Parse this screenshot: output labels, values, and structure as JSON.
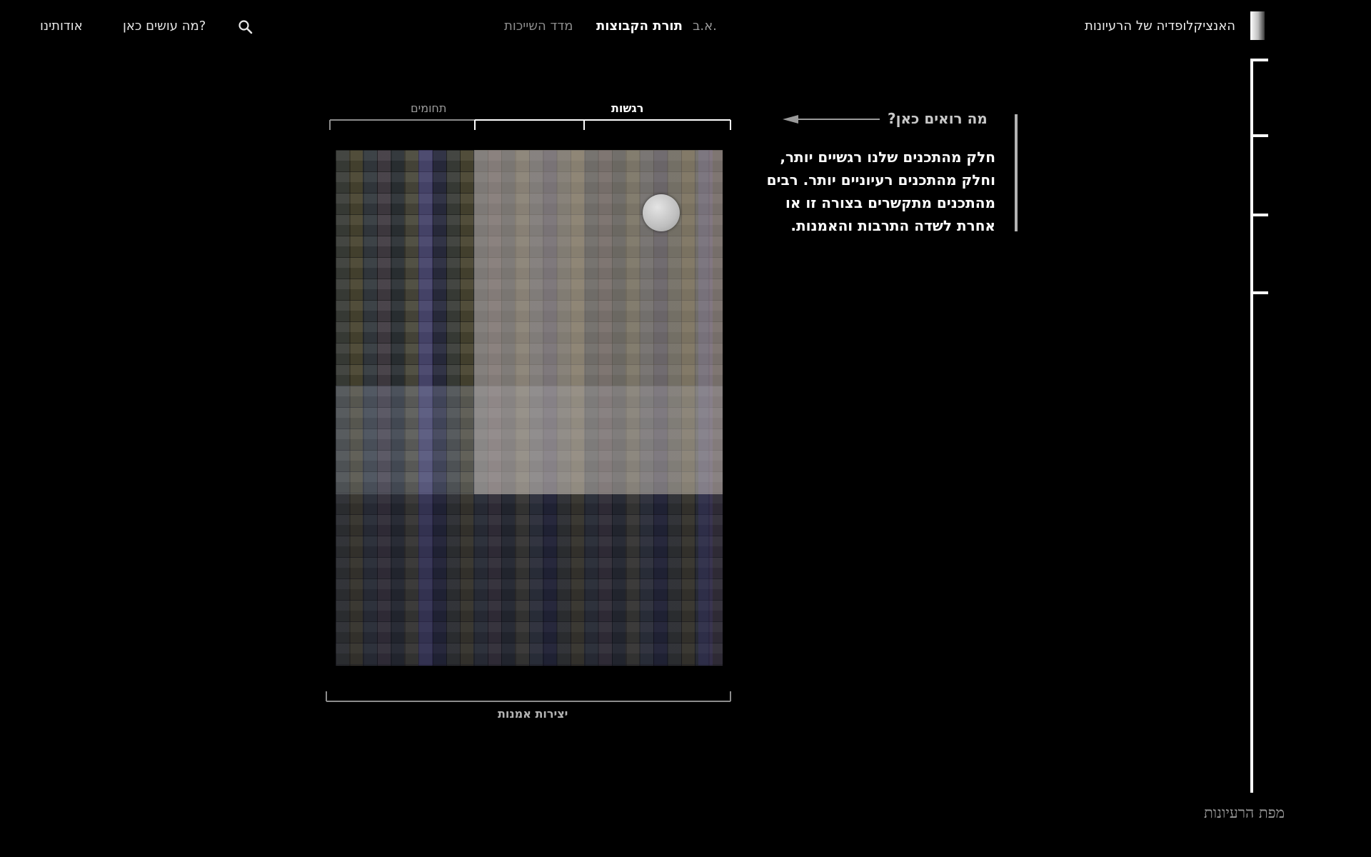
{
  "header": {
    "site_title": "האנציקלופדיה של הרעיונות",
    "nav": {
      "abc": "א.ב.",
      "groups": "תורת הקבוצות",
      "belonging": "מדד השייכות"
    },
    "links": {
      "about": "אודותינו",
      "what": "מה עושים כאן?"
    },
    "search_icon": "search-icon"
  },
  "visualization": {
    "top_labels": {
      "emotions": "רגשות",
      "domains": "תחומים"
    },
    "bottom_label": "יצירות אמנות"
  },
  "explanation": {
    "title": "מה רואים כאן?",
    "body": "חלק מהתכנים שלנו רגשיים יותר, וחלק מהתכנים רעיוניים יותר. רבים מהתכנים מתקשרים בצורה זו או אחרת לשדה התרבות והאמנות."
  },
  "rail": {
    "label": "מפת הרעיונות"
  },
  "colors": {
    "background": "#000000",
    "text": "#ffffff",
    "muted": "#9a9a9a",
    "bracket_active": "#ffffff",
    "bracket_inactive": "#8c8c8c"
  }
}
